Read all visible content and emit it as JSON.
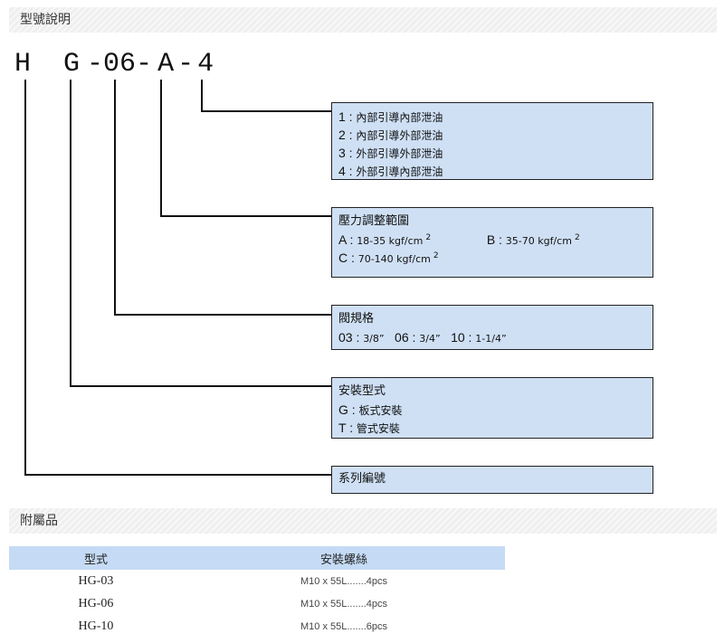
{
  "sections": {
    "model_title": "型號說明",
    "accessories_title": "附屬品"
  },
  "model_code": [
    "H",
    "G",
    "-",
    "06",
    "-",
    "A",
    "-",
    "4"
  ],
  "boxes": {
    "drain": {
      "lines": [
        {
          "key": "1 :",
          "text": "內部引導內部泄油"
        },
        {
          "key": "2 :",
          "text": "內部引導外部泄油"
        },
        {
          "key": "3 :",
          "text": "外部引導外部泄油"
        },
        {
          "key": "4 :",
          "text": "外部引導內部泄油"
        }
      ]
    },
    "pressure": {
      "title": "壓力調整範圍",
      "a_key": "A :",
      "a_val": "18-35 kgf/cm",
      "a_sup": "2",
      "b_key": "B :",
      "b_val": "35-70 kgf/cm",
      "b_sup": "2",
      "c_key": "C :",
      "c_val": "70-140 kgf/cm",
      "c_sup": "2"
    },
    "size": {
      "title": "閥規格",
      "k1": "03 :",
      "v1": "3/8”",
      "k2": "06 :",
      "v2": "3/4”",
      "k3": "10 :",
      "v3": "1-1/4”"
    },
    "mount": {
      "title": "安裝型式",
      "g_key": "G :",
      "g_text": "板式安裝",
      "t_key": "T :",
      "t_text": "管式安裝"
    },
    "series": {
      "title": "系列編號"
    }
  },
  "accessories": {
    "headers": [
      "型式",
      "安裝螺絲"
    ],
    "rows": [
      {
        "model": "HG-03",
        "spec": "M10 x 55L.......4pcs"
      },
      {
        "model": "HG-06",
        "spec": "M10 x 55L.......4pcs"
      },
      {
        "model": "HG-10",
        "spec": "M10 x 55L.......6pcs"
      }
    ]
  }
}
